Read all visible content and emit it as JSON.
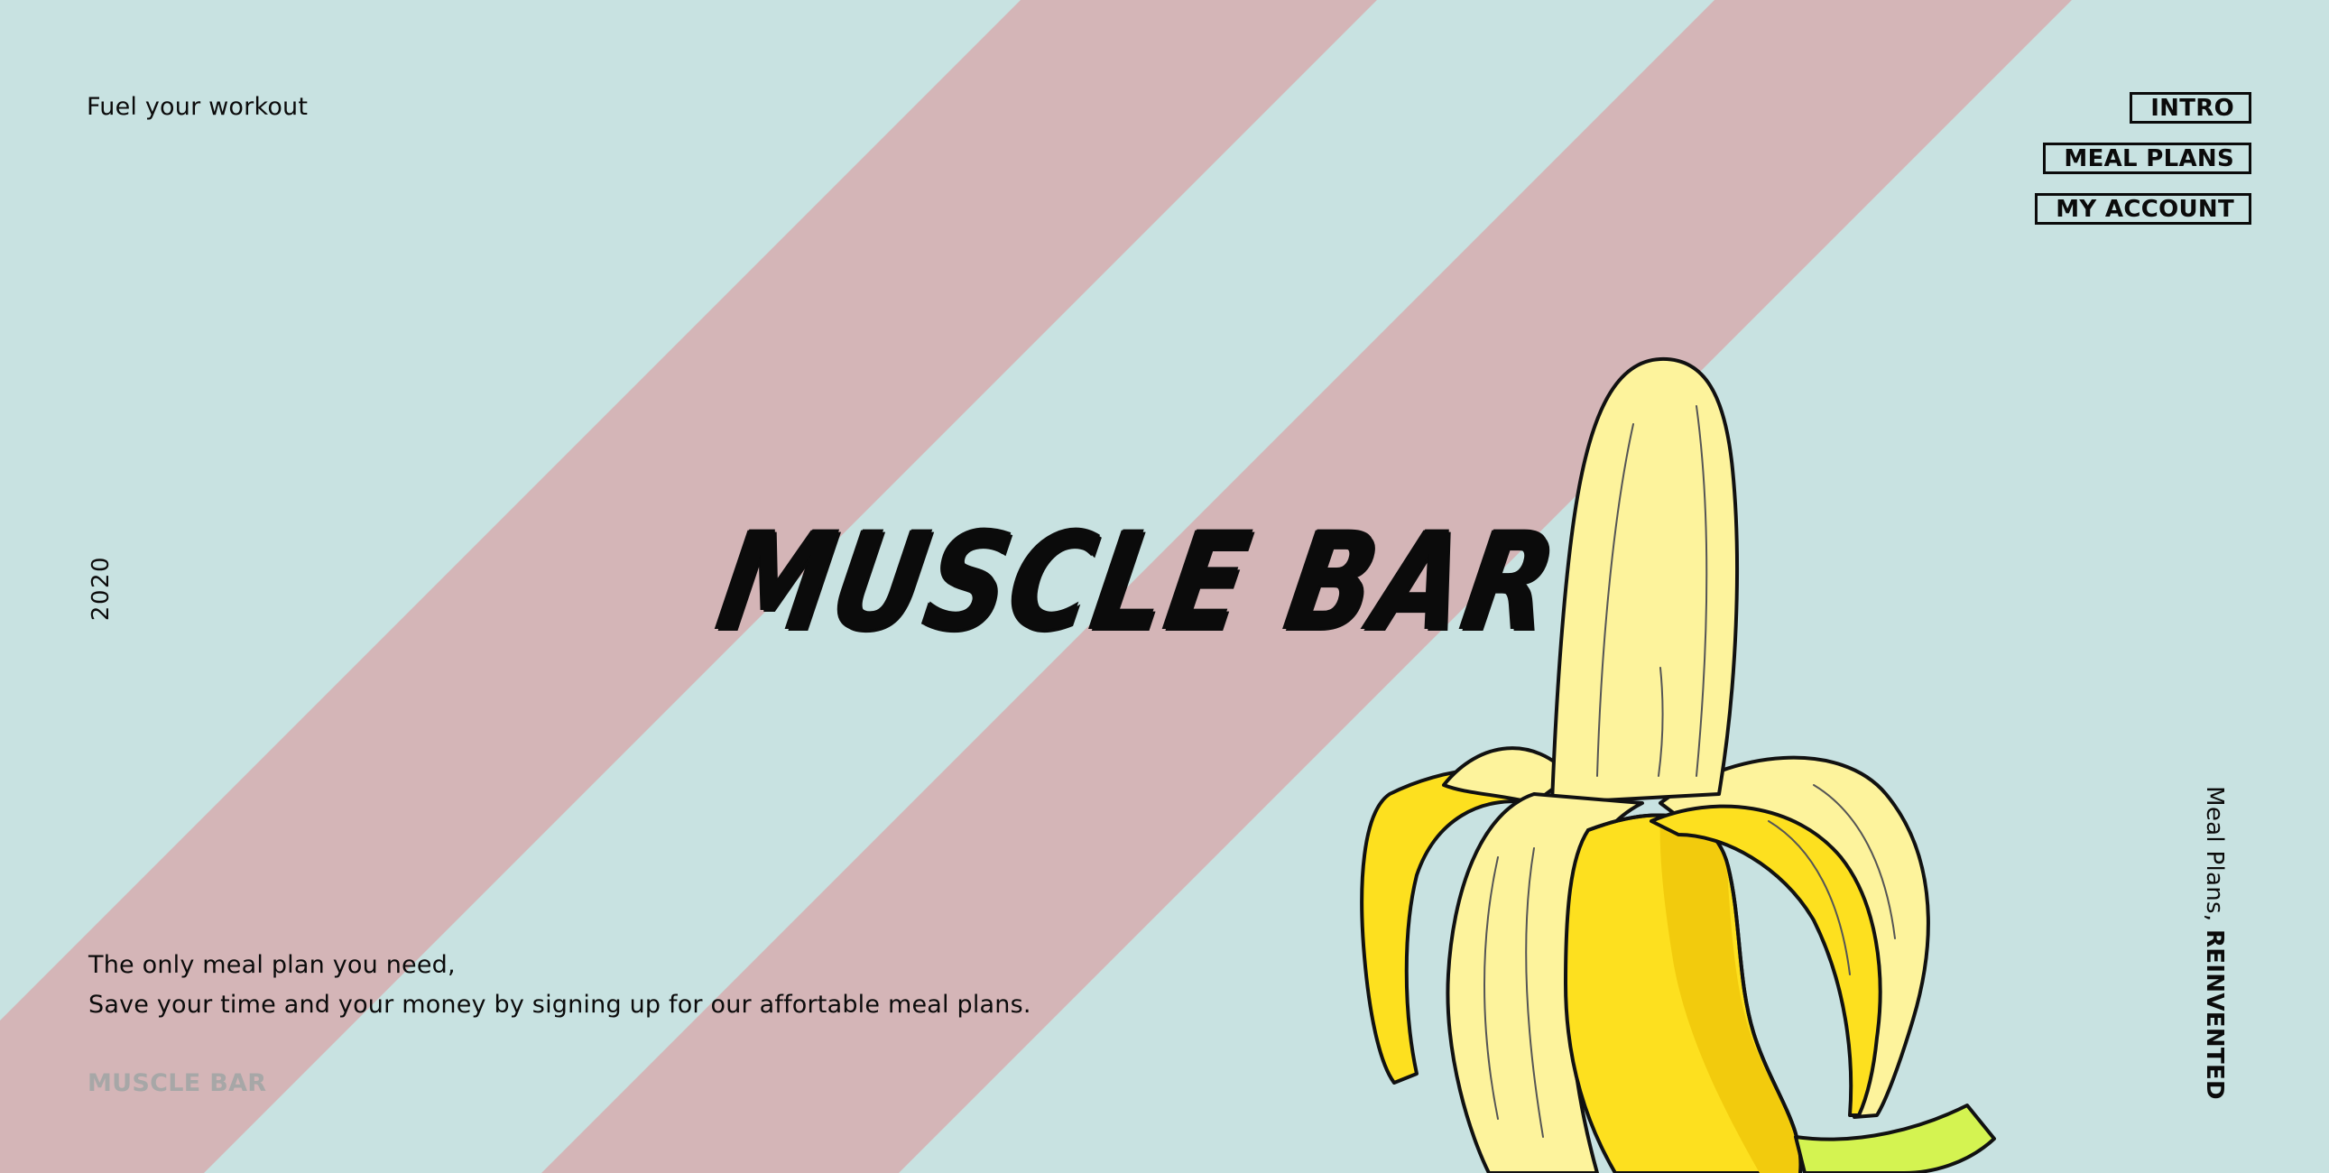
{
  "colors": {
    "background": "#c8e2e1",
    "stripe": "#d4b5b7",
    "text": "#0b0b0b",
    "muted": "#a7a7a7",
    "banana_peel": "#fdf39c",
    "banana_flesh": "#fde01f",
    "banana_shade": "#f2cb0d",
    "banana_stem": "#d4f351"
  },
  "header": {
    "tagline": "Fuel your workout"
  },
  "nav": {
    "items": [
      {
        "label": "INTRO"
      },
      {
        "label": "MEAL PLANS"
      },
      {
        "label": "MY ACCOUNT"
      }
    ]
  },
  "side": {
    "year": "2020",
    "tag_prefix": "Meal Plans, ",
    "tag_bold": "REINVENTED"
  },
  "hero": {
    "title": "MUSCLE BAR",
    "illustration": "banana-illustration"
  },
  "intro": {
    "line1": "The only meal plan you need,",
    "line2": "Save your time and your money by signing up for our affortable meal plans."
  },
  "footer": {
    "brand": "MUSCLE BAR"
  }
}
